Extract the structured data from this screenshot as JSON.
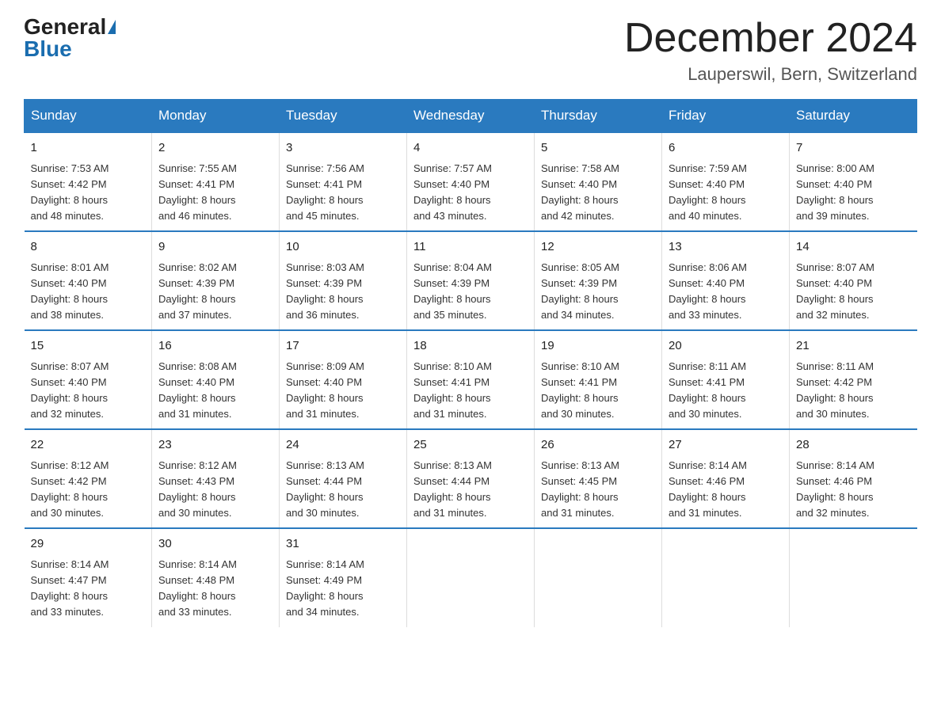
{
  "logo": {
    "general": "General",
    "blue": "Blue"
  },
  "header": {
    "month": "December 2024",
    "location": "Lauperswil, Bern, Switzerland"
  },
  "weekdays": [
    "Sunday",
    "Monday",
    "Tuesday",
    "Wednesday",
    "Thursday",
    "Friday",
    "Saturday"
  ],
  "weeks": [
    [
      {
        "day": "1",
        "info": "Sunrise: 7:53 AM\nSunset: 4:42 PM\nDaylight: 8 hours\nand 48 minutes."
      },
      {
        "day": "2",
        "info": "Sunrise: 7:55 AM\nSunset: 4:41 PM\nDaylight: 8 hours\nand 46 minutes."
      },
      {
        "day": "3",
        "info": "Sunrise: 7:56 AM\nSunset: 4:41 PM\nDaylight: 8 hours\nand 45 minutes."
      },
      {
        "day": "4",
        "info": "Sunrise: 7:57 AM\nSunset: 4:40 PM\nDaylight: 8 hours\nand 43 minutes."
      },
      {
        "day": "5",
        "info": "Sunrise: 7:58 AM\nSunset: 4:40 PM\nDaylight: 8 hours\nand 42 minutes."
      },
      {
        "day": "6",
        "info": "Sunrise: 7:59 AM\nSunset: 4:40 PM\nDaylight: 8 hours\nand 40 minutes."
      },
      {
        "day": "7",
        "info": "Sunrise: 8:00 AM\nSunset: 4:40 PM\nDaylight: 8 hours\nand 39 minutes."
      }
    ],
    [
      {
        "day": "8",
        "info": "Sunrise: 8:01 AM\nSunset: 4:40 PM\nDaylight: 8 hours\nand 38 minutes."
      },
      {
        "day": "9",
        "info": "Sunrise: 8:02 AM\nSunset: 4:39 PM\nDaylight: 8 hours\nand 37 minutes."
      },
      {
        "day": "10",
        "info": "Sunrise: 8:03 AM\nSunset: 4:39 PM\nDaylight: 8 hours\nand 36 minutes."
      },
      {
        "day": "11",
        "info": "Sunrise: 8:04 AM\nSunset: 4:39 PM\nDaylight: 8 hours\nand 35 minutes."
      },
      {
        "day": "12",
        "info": "Sunrise: 8:05 AM\nSunset: 4:39 PM\nDaylight: 8 hours\nand 34 minutes."
      },
      {
        "day": "13",
        "info": "Sunrise: 8:06 AM\nSunset: 4:40 PM\nDaylight: 8 hours\nand 33 minutes."
      },
      {
        "day": "14",
        "info": "Sunrise: 8:07 AM\nSunset: 4:40 PM\nDaylight: 8 hours\nand 32 minutes."
      }
    ],
    [
      {
        "day": "15",
        "info": "Sunrise: 8:07 AM\nSunset: 4:40 PM\nDaylight: 8 hours\nand 32 minutes."
      },
      {
        "day": "16",
        "info": "Sunrise: 8:08 AM\nSunset: 4:40 PM\nDaylight: 8 hours\nand 31 minutes."
      },
      {
        "day": "17",
        "info": "Sunrise: 8:09 AM\nSunset: 4:40 PM\nDaylight: 8 hours\nand 31 minutes."
      },
      {
        "day": "18",
        "info": "Sunrise: 8:10 AM\nSunset: 4:41 PM\nDaylight: 8 hours\nand 31 minutes."
      },
      {
        "day": "19",
        "info": "Sunrise: 8:10 AM\nSunset: 4:41 PM\nDaylight: 8 hours\nand 30 minutes."
      },
      {
        "day": "20",
        "info": "Sunrise: 8:11 AM\nSunset: 4:41 PM\nDaylight: 8 hours\nand 30 minutes."
      },
      {
        "day": "21",
        "info": "Sunrise: 8:11 AM\nSunset: 4:42 PM\nDaylight: 8 hours\nand 30 minutes."
      }
    ],
    [
      {
        "day": "22",
        "info": "Sunrise: 8:12 AM\nSunset: 4:42 PM\nDaylight: 8 hours\nand 30 minutes."
      },
      {
        "day": "23",
        "info": "Sunrise: 8:12 AM\nSunset: 4:43 PM\nDaylight: 8 hours\nand 30 minutes."
      },
      {
        "day": "24",
        "info": "Sunrise: 8:13 AM\nSunset: 4:44 PM\nDaylight: 8 hours\nand 30 minutes."
      },
      {
        "day": "25",
        "info": "Sunrise: 8:13 AM\nSunset: 4:44 PM\nDaylight: 8 hours\nand 31 minutes."
      },
      {
        "day": "26",
        "info": "Sunrise: 8:13 AM\nSunset: 4:45 PM\nDaylight: 8 hours\nand 31 minutes."
      },
      {
        "day": "27",
        "info": "Sunrise: 8:14 AM\nSunset: 4:46 PM\nDaylight: 8 hours\nand 31 minutes."
      },
      {
        "day": "28",
        "info": "Sunrise: 8:14 AM\nSunset: 4:46 PM\nDaylight: 8 hours\nand 32 minutes."
      }
    ],
    [
      {
        "day": "29",
        "info": "Sunrise: 8:14 AM\nSunset: 4:47 PM\nDaylight: 8 hours\nand 33 minutes."
      },
      {
        "day": "30",
        "info": "Sunrise: 8:14 AM\nSunset: 4:48 PM\nDaylight: 8 hours\nand 33 minutes."
      },
      {
        "day": "31",
        "info": "Sunrise: 8:14 AM\nSunset: 4:49 PM\nDaylight: 8 hours\nand 34 minutes."
      },
      null,
      null,
      null,
      null
    ]
  ]
}
